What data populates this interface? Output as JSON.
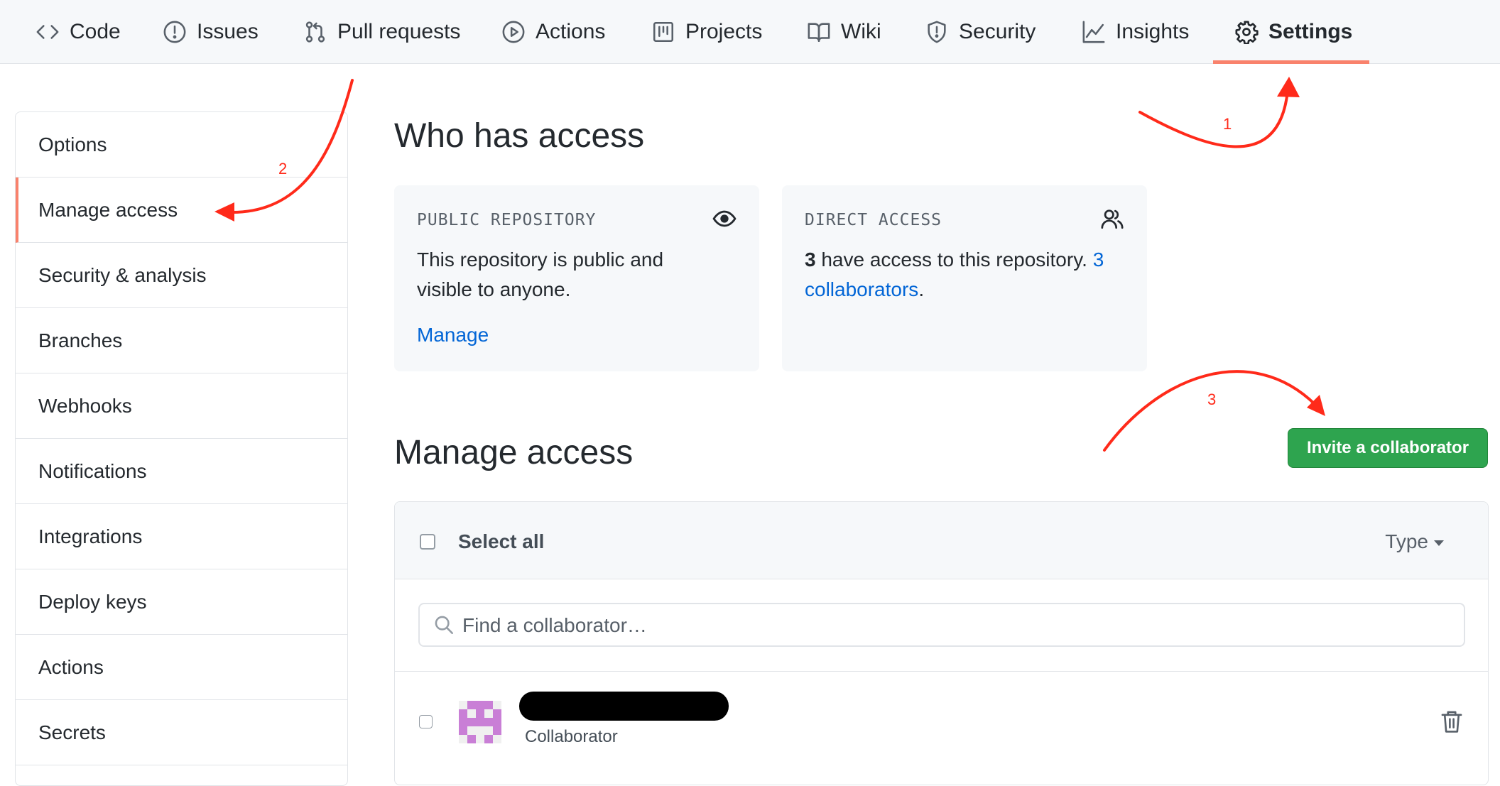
{
  "nav": {
    "tabs": [
      {
        "label": "Code",
        "icon": "code-icon"
      },
      {
        "label": "Issues",
        "icon": "issue-opened-icon"
      },
      {
        "label": "Pull requests",
        "icon": "git-pull-request-icon"
      },
      {
        "label": "Actions",
        "icon": "play-icon"
      },
      {
        "label": "Projects",
        "icon": "project-icon"
      },
      {
        "label": "Wiki",
        "icon": "book-icon"
      },
      {
        "label": "Security",
        "icon": "shield-icon"
      },
      {
        "label": "Insights",
        "icon": "graph-icon"
      },
      {
        "label": "Settings",
        "icon": "gear-icon",
        "selected": true
      }
    ]
  },
  "sidebar": {
    "items": [
      {
        "label": "Options"
      },
      {
        "label": "Manage access",
        "active": true
      },
      {
        "label": "Security & analysis"
      },
      {
        "label": "Branches"
      },
      {
        "label": "Webhooks"
      },
      {
        "label": "Notifications"
      },
      {
        "label": "Integrations"
      },
      {
        "label": "Deploy keys"
      },
      {
        "label": "Actions"
      },
      {
        "label": "Secrets"
      }
    ]
  },
  "who_has_access": {
    "title": "Who has access",
    "public_card": {
      "heading": "PUBLIC REPOSITORY",
      "text": "This repository is public and visible to anyone.",
      "link": "Manage"
    },
    "direct_card": {
      "heading": "DIRECT ACCESS",
      "count": "3",
      "text": " have access to this repository. ",
      "link": "3 collaborators",
      "suffix": "."
    }
  },
  "manage_access": {
    "title": "Manage access",
    "invite_button": "Invite a collaborator",
    "select_all": "Select all",
    "type_menu": "Type",
    "search_placeholder": "Find a collaborator…",
    "collaborators": [
      {
        "role": "Collaborator"
      }
    ]
  },
  "annotations": {
    "step1": "1",
    "step2": "2",
    "step3": "3"
  },
  "colors": {
    "accent_underline": "#f9826c",
    "link": "#0366d6",
    "invite_button": "#2ea44f",
    "annotation": "#ff2a1a"
  }
}
